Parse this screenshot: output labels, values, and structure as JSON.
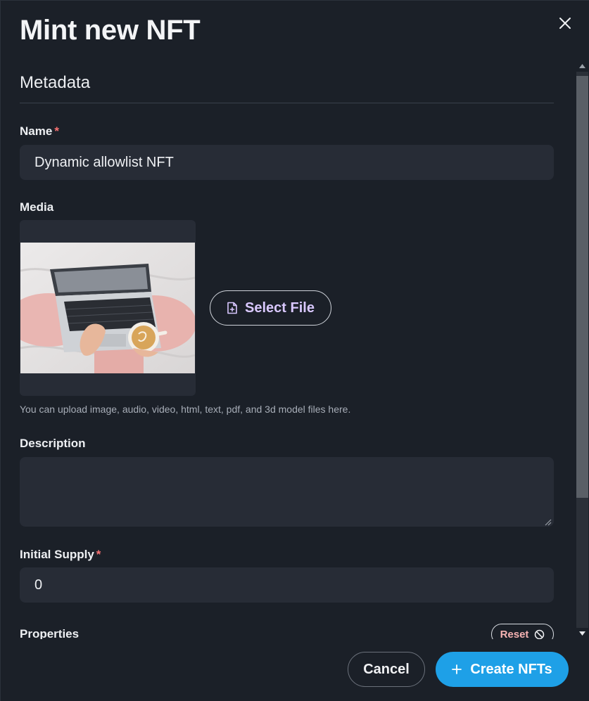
{
  "modal": {
    "title": "Mint new NFT",
    "close_icon": "close-icon"
  },
  "metadata": {
    "section_title": "Metadata",
    "name": {
      "label": "Name",
      "required_mark": "*",
      "value": "Dynamic allowlist NFT"
    },
    "media": {
      "label": "Media",
      "select_file_label": "Select File",
      "select_file_icon": "file-plus-icon",
      "help_text": "You can upload image, audio, video, html, text, pdf, and 3d model files here."
    },
    "description": {
      "label": "Description",
      "value": ""
    },
    "initial_supply": {
      "label": "Initial Supply",
      "required_mark": "*",
      "value": "0"
    },
    "properties": {
      "label": "Properties",
      "reset_label": "Reset",
      "reset_icon": "ban-icon"
    }
  },
  "footer": {
    "cancel_label": "Cancel",
    "create_label": "Create NFTs",
    "create_icon": "plus-icon"
  },
  "colors": {
    "background": "#1b2028",
    "input_bg": "#272c36",
    "accent": "#1ea0e7",
    "required": "#f87171",
    "select_file_text": "#d9c8ff"
  }
}
